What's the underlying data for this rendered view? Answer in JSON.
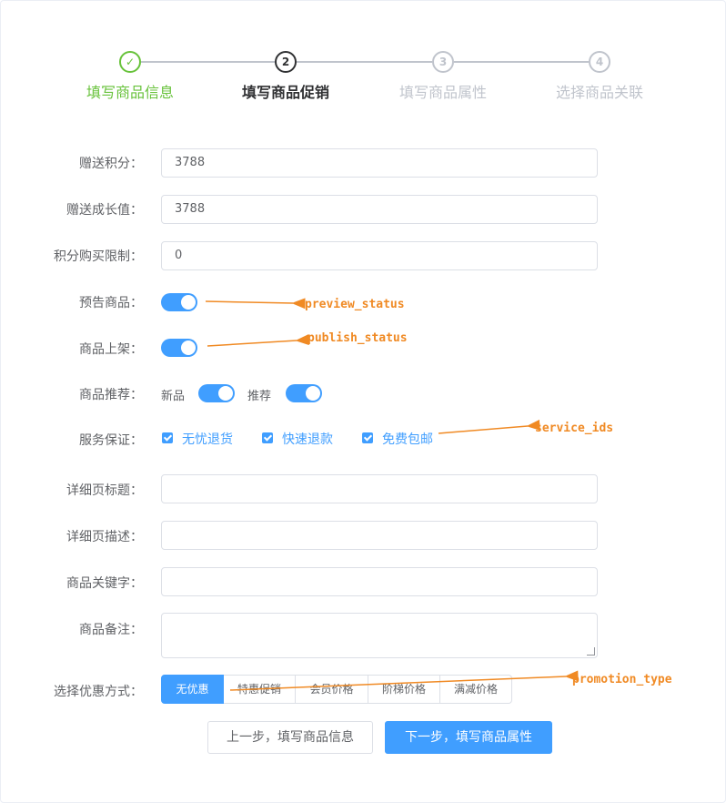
{
  "steps": [
    {
      "label": "填写商品信息",
      "marker": "✓",
      "state": "success"
    },
    {
      "label": "填写商品促销",
      "marker": "2",
      "state": "process"
    },
    {
      "label": "填写商品属性",
      "marker": "3",
      "state": "wait"
    },
    {
      "label": "选择商品关联",
      "marker": "4",
      "state": "wait"
    }
  ],
  "form": {
    "gift_points": {
      "label": "赠送积分：",
      "value": "3788"
    },
    "gift_growth": {
      "label": "赠送成长值：",
      "value": "3788"
    },
    "points_limit": {
      "label": "积分购买限制：",
      "value": "0"
    },
    "preview": {
      "label": "预告商品：",
      "on": true
    },
    "publish": {
      "label": "商品上架：",
      "on": true
    },
    "recommend": {
      "label": "商品推荐：",
      "new_label": "新品",
      "new_on": true,
      "rec_label": "推荐",
      "rec_on": true
    },
    "service": {
      "label": "服务保证：",
      "options": [
        {
          "label": "无忧退货",
          "checked": true
        },
        {
          "label": "快速退款",
          "checked": true
        },
        {
          "label": "免费包邮",
          "checked": true
        }
      ]
    },
    "detail_title": {
      "label": "详细页标题：",
      "value": ""
    },
    "detail_desc": {
      "label": "详细页描述：",
      "value": ""
    },
    "keywords": {
      "label": "商品关键字：",
      "value": ""
    },
    "note": {
      "label": "商品备注：",
      "value": ""
    },
    "promotion": {
      "label": "选择优惠方式：",
      "options": [
        "无优惠",
        "特惠促销",
        "会员价格",
        "阶梯价格",
        "满减价格"
      ],
      "selected": "无优惠"
    }
  },
  "buttons": {
    "prev": "上一步，填写商品信息",
    "next": "下一步，填写商品属性"
  },
  "annotations": {
    "preview": "preview_status",
    "publish": "publish_status",
    "service": "service_ids",
    "promotion": "promotion_type"
  },
  "colors": {
    "primary": "#409eff",
    "success": "#67c23a",
    "annotation": "#f08a24"
  }
}
